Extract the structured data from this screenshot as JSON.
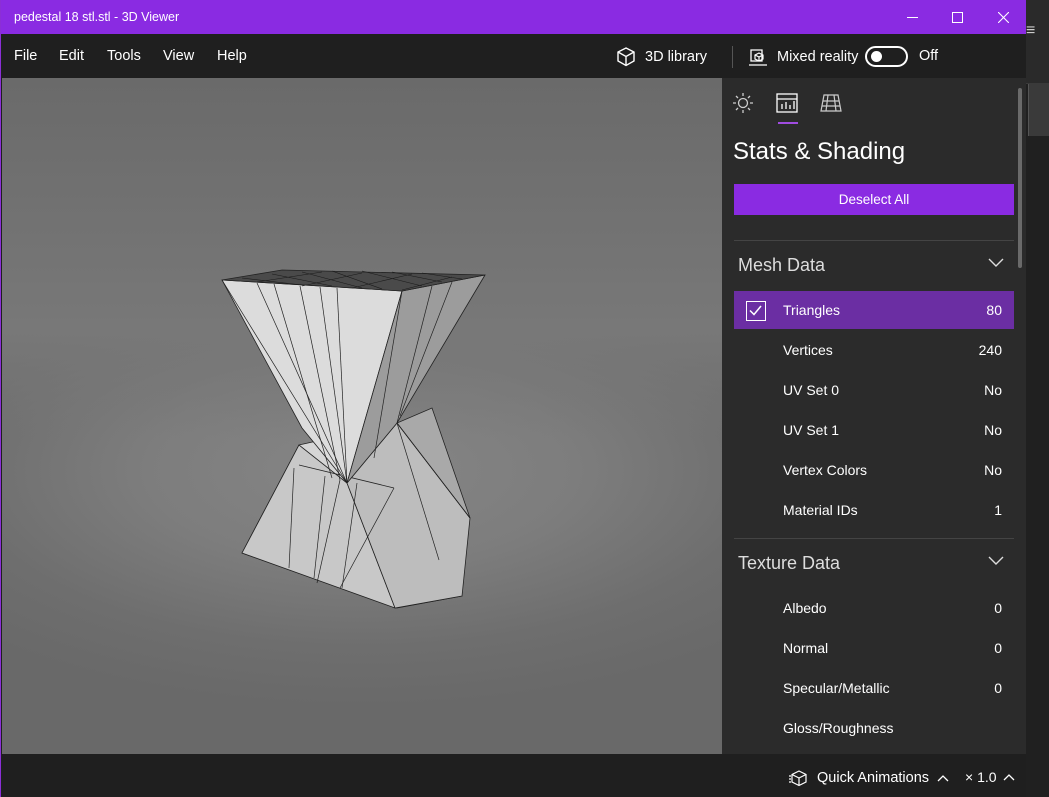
{
  "window": {
    "title": "pedestal 18 stl.stl - 3D Viewer"
  },
  "accent": "#8a2be2",
  "menu": {
    "file": "File",
    "edit": "Edit",
    "tools": "Tools",
    "view": "View",
    "help": "Help"
  },
  "toolbar": {
    "library_label": "3D library",
    "library_icon": "cube-icon",
    "mixed_reality_label": "Mixed reality",
    "mixed_reality_state": "Off"
  },
  "panel": {
    "tabs": [
      "lighting",
      "stats-shading",
      "grid"
    ],
    "title": "Stats & Shading",
    "deselect_label": "Deselect All",
    "mesh": {
      "heading": "Mesh Data",
      "rows": [
        {
          "label": "Triangles",
          "value": "80"
        },
        {
          "label": "Vertices",
          "value": "240"
        },
        {
          "label": "UV Set 0",
          "value": "No"
        },
        {
          "label": "UV Set 1",
          "value": "No"
        },
        {
          "label": "Vertex Colors",
          "value": "No"
        },
        {
          "label": "Material IDs",
          "value": "1"
        }
      ]
    },
    "texture": {
      "heading": "Texture Data",
      "rows": [
        {
          "label": "Albedo",
          "value": "0"
        },
        {
          "label": "Normal",
          "value": "0"
        },
        {
          "label": "Specular/Metallic",
          "value": "0"
        },
        {
          "label": "Gloss/Roughness",
          "value": ""
        }
      ]
    }
  },
  "status": {
    "animations_label": "Quick Animations",
    "speed": "× 1.0"
  }
}
